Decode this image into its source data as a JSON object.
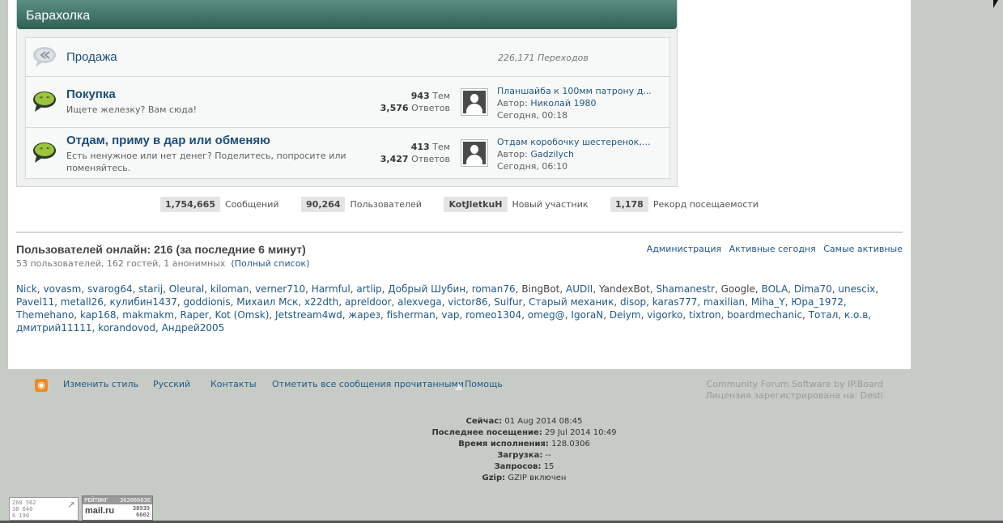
{
  "category": {
    "title": "Барахолка"
  },
  "forums": [
    {
      "name": "Продажа",
      "redirects": "226,171 Переходов"
    },
    {
      "name": "Покупка",
      "description": "Ищете железку? Вам сюда!",
      "topics": "943",
      "topics_label": "Тем",
      "replies": "3,576",
      "replies_label": "Ответов",
      "last_title": "Планшайба к 100мм патрону д...",
      "last_author_label": "Автор:",
      "last_author": "Николай 1980",
      "last_time": "Сегодня, 00:18"
    },
    {
      "name": "Отдам, приму в дар или обменяю",
      "description": "Есть ненужное или нет денег? Поделитесь, попросите или поменяйтесь.",
      "topics": "413",
      "topics_label": "Тем",
      "replies": "3,427",
      "replies_label": "Ответов",
      "last_title": "Отдам коробочку шестеренок,...",
      "last_author_label": "Автор:",
      "last_author": "Gadzilych",
      "last_time": "Сегодня, 06:10"
    }
  ],
  "board_stats": [
    {
      "value": "1,754,665",
      "label": "Сообщений"
    },
    {
      "value": "90,264",
      "label": "Пользователей"
    },
    {
      "value": "KotJletkuH",
      "label": "Новый участник"
    },
    {
      "value": "1,178",
      "label": "Рекорд посещаемости"
    }
  ],
  "online": {
    "title": "Пользователей онлайн: 216 (за последние 6 минут)",
    "summary": "53 пользователей, 162 гостей, 1 анонимных",
    "full_list": "(Полный список)",
    "links": [
      "Администрация",
      "Активные сегодня",
      "Самые активные"
    ],
    "names": [
      "Nick",
      "vovasm",
      "svarog64",
      "starij",
      "Oleural",
      "kiloman",
      "verner710",
      "Harmful",
      "artlip",
      "Добрый Шубин",
      "roman76",
      "BingBot",
      "AUDII",
      "YandexBot",
      "Shamanestr",
      "Google",
      "BOLA",
      "Dima70",
      "unescix",
      "Pavel11",
      "metall26",
      "кулибин1437",
      "goddionis",
      "Михаил Мск",
      "x22dth",
      "apreldoor",
      "alexvega",
      "victor86",
      "Sulfur",
      "Старый механик",
      "disop",
      "karas777",
      "maxilian",
      "Miha_Y",
      "Юра_1972",
      "Themehano",
      "kap168",
      "makmakm",
      "Raper",
      "Kot (Omsk)",
      "Jetstream4wd",
      "жарез",
      "fisherman",
      "vap",
      "romeo1304",
      "omeg@",
      "IgoraN",
      "Deiym",
      "vigorko",
      "tixtron",
      "boardmechanic",
      "Тотал",
      "к.о.в",
      "дмитрий11111",
      "korandovod",
      "Андрей2005"
    ],
    "bots": [
      "BingBot",
      "YandexBot",
      "Google"
    ]
  },
  "footer": {
    "links": [
      "Изменить стиль",
      "Русский",
      "Контакты",
      "Отметить все сообщения прочитанными",
      "Помощь"
    ],
    "ipb_line1": "Community Forum Software by IP.Board",
    "ipb_line2": "Лицензия зарегистрирована на: Desti",
    "info": [
      {
        "label": "Сейчас:",
        "value": "01 Aug 2014 08:45"
      },
      {
        "label": "Последнее посещение:",
        "value": "29 Jul 2014 10:49"
      },
      {
        "label": "Время исполнения:",
        "value": "128.0306"
      },
      {
        "label": "Загрузка:",
        "value": "--"
      },
      {
        "label": "Запросов:",
        "value": "15"
      },
      {
        "label": "Gzip:",
        "value": "GZIP включен"
      }
    ]
  },
  "counters": {
    "liveinternet": [
      "260 562",
      "38 640",
      "6 190"
    ],
    "mail_title": "РЕЙТИНГ",
    "mail_id": "362066636",
    "mail_brand": "mail.ru",
    "mail_vals": [
      "38939",
      "6602"
    ]
  }
}
